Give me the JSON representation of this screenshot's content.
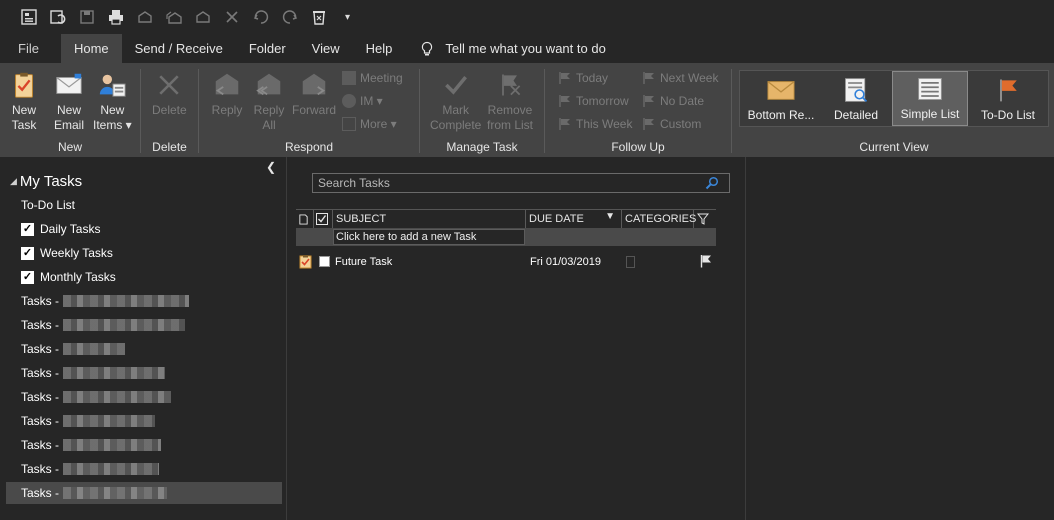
{
  "menubar": {
    "tabs": [
      "File",
      "Home",
      "Send / Receive",
      "Folder",
      "View",
      "Help"
    ],
    "tell_me": "Tell me what you want to do"
  },
  "ribbon": {
    "new_group": {
      "label": "New",
      "new_task": [
        "New",
        "Task"
      ],
      "new_email": [
        "New",
        "Email"
      ],
      "new_items": [
        "New",
        "Items ▾"
      ]
    },
    "delete_group": {
      "label": "Delete",
      "delete": "Delete"
    },
    "respond_group": {
      "label": "Respond",
      "reply": "Reply",
      "reply_all": [
        "Reply",
        "All"
      ],
      "forward": "Forward",
      "meeting": "Meeting",
      "im": "IM ▾",
      "more": "More ▾"
    },
    "manage_group": {
      "label": "Manage Task",
      "mark_complete": [
        "Mark",
        "Complete"
      ],
      "remove_from_list": [
        "Remove",
        "from List"
      ]
    },
    "follow_group": {
      "label": "Follow Up",
      "today": "Today",
      "tomorrow": "Tomorrow",
      "this_week": "This Week",
      "next_week": "Next Week",
      "no_date": "No Date",
      "custom": "Custom"
    },
    "view_group": {
      "label": "Current View",
      "views": [
        "Bottom Re...",
        "Detailed",
        "Simple List",
        "To-Do List"
      ],
      "selected": "Simple List"
    }
  },
  "nav": {
    "header": "My Tasks",
    "todo": "To-Do List",
    "checked_items": [
      "Daily Tasks",
      "Weekly Tasks",
      "Monthly Tasks"
    ],
    "task_prefix": "Tasks -"
  },
  "tasklist": {
    "search_placeholder": "Search Tasks",
    "columns": {
      "subject": "SUBJECT",
      "due": "DUE DATE",
      "categories": "CATEGORIES"
    },
    "new_task_prompt": "Click here to add a new Task",
    "rows": [
      {
        "subject": "Future Task",
        "due": "Fri 01/03/2019"
      }
    ]
  },
  "colors": {
    "bg": "#262626",
    "ribbon": "#444444",
    "accent_flag": "#e06c2c"
  }
}
